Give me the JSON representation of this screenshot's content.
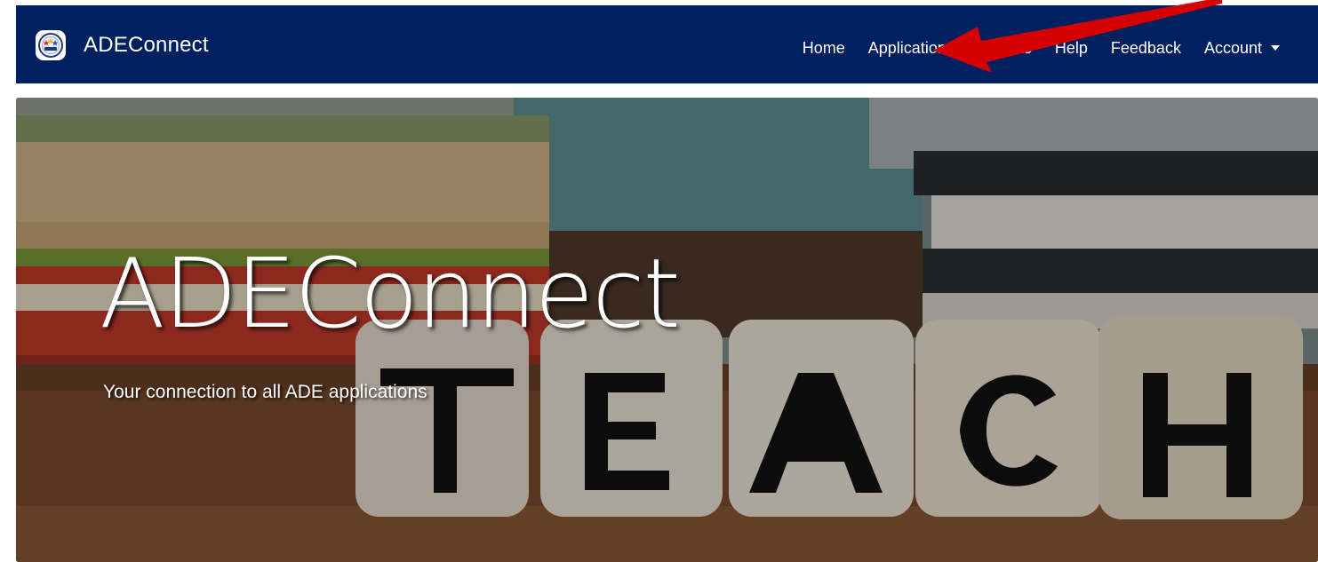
{
  "navbar": {
    "brand": "ADEConnect",
    "items": [
      {
        "label": "Home"
      },
      {
        "label": "Applications"
      },
      {
        "label": "orts"
      },
      {
        "label": "Help"
      },
      {
        "label": "Feedback"
      },
      {
        "label": "Account"
      }
    ],
    "colors": {
      "background": "#002060",
      "text": "#ffffff"
    }
  },
  "hero": {
    "title": "ADEConnect",
    "subtitle": "Your connection to all ADE applications",
    "dice_letters": [
      "T",
      "E",
      "A",
      "C",
      "H"
    ]
  },
  "annotation": {
    "arrow_color": "#d50000",
    "arrow_icon": "red-arrow-icon"
  }
}
